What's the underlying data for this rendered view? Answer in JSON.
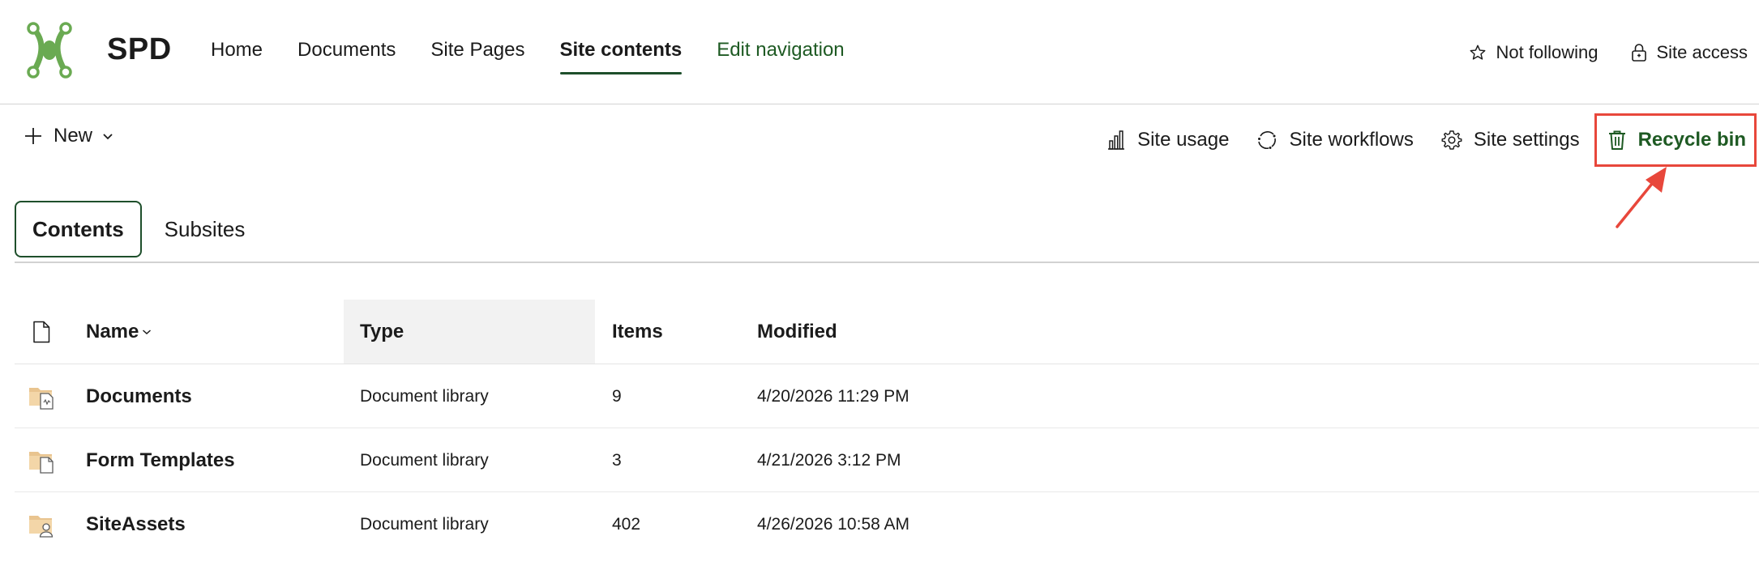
{
  "site": {
    "title": "SPD",
    "logo_icon": "spd-logo-icon"
  },
  "topnav": {
    "items": [
      {
        "label": "Home"
      },
      {
        "label": "Documents"
      },
      {
        "label": "Site Pages"
      },
      {
        "label": "Site contents",
        "active": true
      },
      {
        "label": "Edit navigation"
      }
    ],
    "follow_label": "Not following",
    "access_label": "Site access"
  },
  "commandbar": {
    "new_label": "New",
    "site_usage_label": "Site usage",
    "site_workflows_label": "Site workflows",
    "site_settings_label": "Site settings",
    "recycle_bin_label": "Recycle bin"
  },
  "tabs": {
    "contents_label": "Contents",
    "subsites_label": "Subsites"
  },
  "list": {
    "headers": {
      "name": "Name",
      "type": "Type",
      "items": "Items",
      "modified": "Modified"
    },
    "rows": [
      {
        "name": "Documents",
        "type": "Document library",
        "items": "9",
        "modified": "4/20/2026 11:29 PM",
        "icon": "document-library-icon"
      },
      {
        "name": "Form Templates",
        "type": "Document library",
        "items": "3",
        "modified": "4/21/2026 3:12 PM",
        "icon": "form-templates-library-icon"
      },
      {
        "name": "SiteAssets",
        "type": "Document library",
        "items": "402",
        "modified": "4/26/2026 10:58 AM",
        "icon": "site-assets-library-icon"
      }
    ]
  },
  "colors": {
    "accent_green": "#1e5a23",
    "annotation_red": "#e8473b",
    "logo_green": "#6aaa52"
  }
}
